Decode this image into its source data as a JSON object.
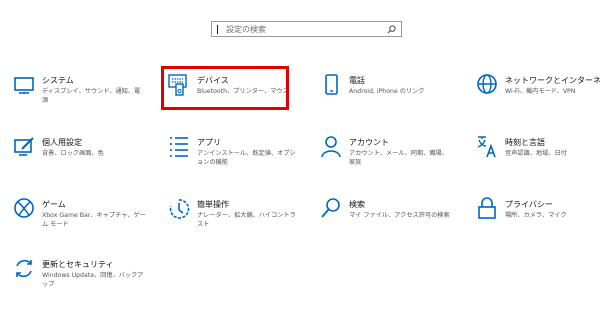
{
  "search": {
    "placeholder": "設定の検索"
  },
  "accent_color": "#0067c0",
  "highlight_color": "#e10000",
  "items": [
    {
      "title": "システム",
      "desc": "ディスプレイ、サウンド、通知、電源",
      "icon": "monitor-icon"
    },
    {
      "title": "デバイス",
      "desc": "Bluetooth、プリンター、マウス",
      "icon": "keyboard-icon"
    },
    {
      "title": "電話",
      "desc": "Android, iPhone のリンク",
      "icon": "phone-icon"
    },
    {
      "title": "ネットワークとインターネット",
      "desc": "Wi-Fi、機内モード、VPN",
      "icon": "globe-icon"
    },
    {
      "title": "個人用設定",
      "desc": "背景、ロック画面、色",
      "icon": "personalization-icon"
    },
    {
      "title": "アプリ",
      "desc": "アンインストール、既定値、オプションの機能",
      "icon": "apps-list-icon"
    },
    {
      "title": "アカウント",
      "desc": "アカウント、メール、同期、職場、家族",
      "icon": "person-icon"
    },
    {
      "title": "時刻と言語",
      "desc": "音声認識、地域、日付",
      "icon": "time-language-icon"
    },
    {
      "title": "ゲーム",
      "desc": "Xbox Game Bar、キャプチャ、ゲーム モード",
      "icon": "xbox-icon"
    },
    {
      "title": "簡単操作",
      "desc": "ナレーター、拡大鏡、ハイコントラスト",
      "icon": "ease-of-access-icon"
    },
    {
      "title": "検索",
      "desc": "マイ ファイル、アクセス許可の検索",
      "icon": "search-icon"
    },
    {
      "title": "プライバシー",
      "desc": "場所、カメラ、マイク",
      "icon": "lock-icon"
    },
    {
      "title": "更新とセキュリティ",
      "desc": "Windows Update、回復、バックアップ",
      "icon": "update-icon"
    }
  ]
}
